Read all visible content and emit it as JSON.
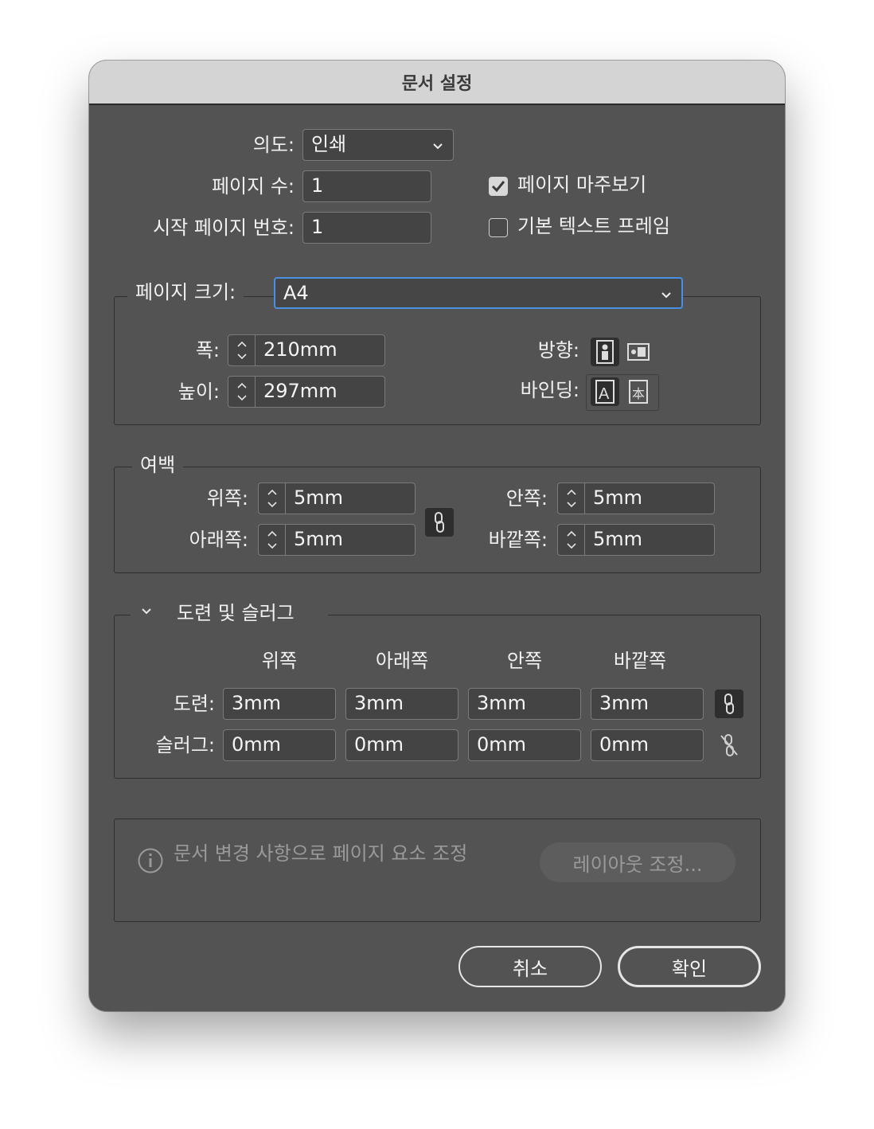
{
  "window": {
    "title": "문서 설정"
  },
  "intent": {
    "label": "의도:",
    "value": "인쇄"
  },
  "page_count": {
    "label": "페이지 수:",
    "value": "1"
  },
  "start_page": {
    "label": "시작 페이지 번호:",
    "value": "1"
  },
  "facing_pages": {
    "label": "페이지 마주보기",
    "checked": true
  },
  "primary_text_frame": {
    "label": "기본 텍스트 프레임",
    "checked": false
  },
  "page_size": {
    "label": "페이지 크기:",
    "value": "A4",
    "width": {
      "label": "폭:",
      "value": "210mm"
    },
    "height": {
      "label": "높이:",
      "value": "297mm"
    },
    "orientation": {
      "label": "방향:",
      "selected": "portrait-icon"
    },
    "binding": {
      "label": "바인딩:",
      "selected": "left-to-right-binding-icon",
      "ltr_glyph": "A",
      "rtl_glyph": "本"
    }
  },
  "margins": {
    "legend": "여백",
    "top": {
      "label": "위쪽:",
      "value": "5mm"
    },
    "bottom": {
      "label": "아래쪽:",
      "value": "5mm"
    },
    "inside": {
      "label": "안쪽:",
      "value": "5mm"
    },
    "outside": {
      "label": "바깥쪽:",
      "value": "5mm"
    }
  },
  "bleed_slug": {
    "legend": "도련 및 슬러그",
    "columns": [
      "위쪽",
      "아래쪽",
      "안쪽",
      "바깥쪽"
    ],
    "bleed": {
      "label": "도련:",
      "values": [
        "3mm",
        "3mm",
        "3mm",
        "3mm"
      ]
    },
    "slug": {
      "label": "슬러그:",
      "values": [
        "0mm",
        "0mm",
        "0mm",
        "0mm"
      ]
    }
  },
  "adjust": {
    "info_text": "문서 변경 사항으로 페이지 요소 조정",
    "button_label": "레이아웃 조정..."
  },
  "buttons": {
    "cancel": "취소",
    "ok": "확인"
  },
  "colors": {
    "dialog_bg": "#535353",
    "titlebar_bg": "#d4d4d4",
    "focus_ring": "#4a90e2"
  }
}
